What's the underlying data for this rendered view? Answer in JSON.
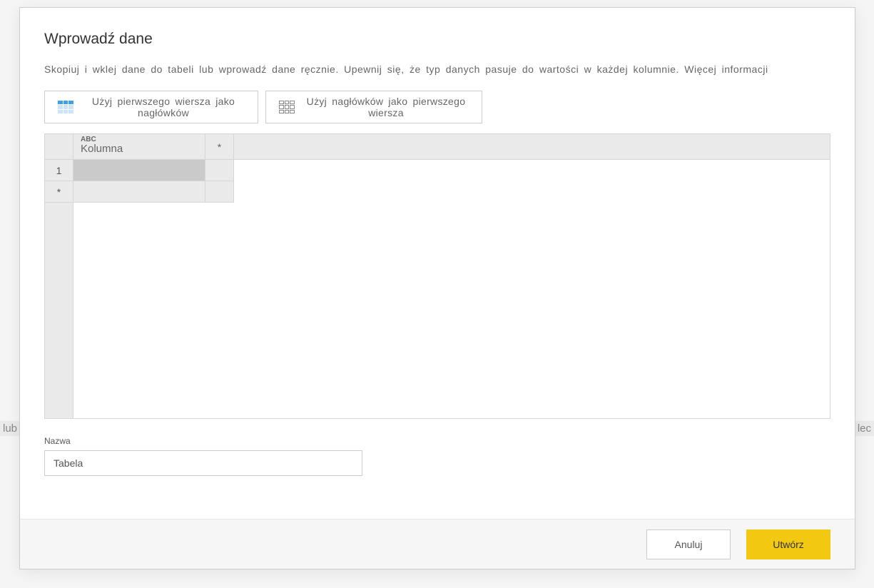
{
  "bg": {
    "left": "lub",
    "right": "lec"
  },
  "dialog": {
    "title": "Wprowadź dane",
    "description": "Skopiuj i wklej dane do tabeli lub wprowadź dane ręcznie. Upewnij się, że typ danych pasuje do wartości w każdej kolumnie. Więcej informacji",
    "toolbar": {
      "btn1": "Użyj pierwszego wiersza jako nagłówków",
      "btn2": "Użyj nagłówków jako pierwszego wiersza"
    },
    "grid": {
      "column_type": "ABC",
      "column_name": "Kolumna",
      "add_col": "*",
      "rows": [
        {
          "num": "1",
          "value": ""
        }
      ],
      "add_row": "*"
    },
    "name_label": "Nazwa",
    "name_value": "Tabela",
    "footer": {
      "cancel": "Anuluj",
      "create": "Utwórz"
    }
  }
}
